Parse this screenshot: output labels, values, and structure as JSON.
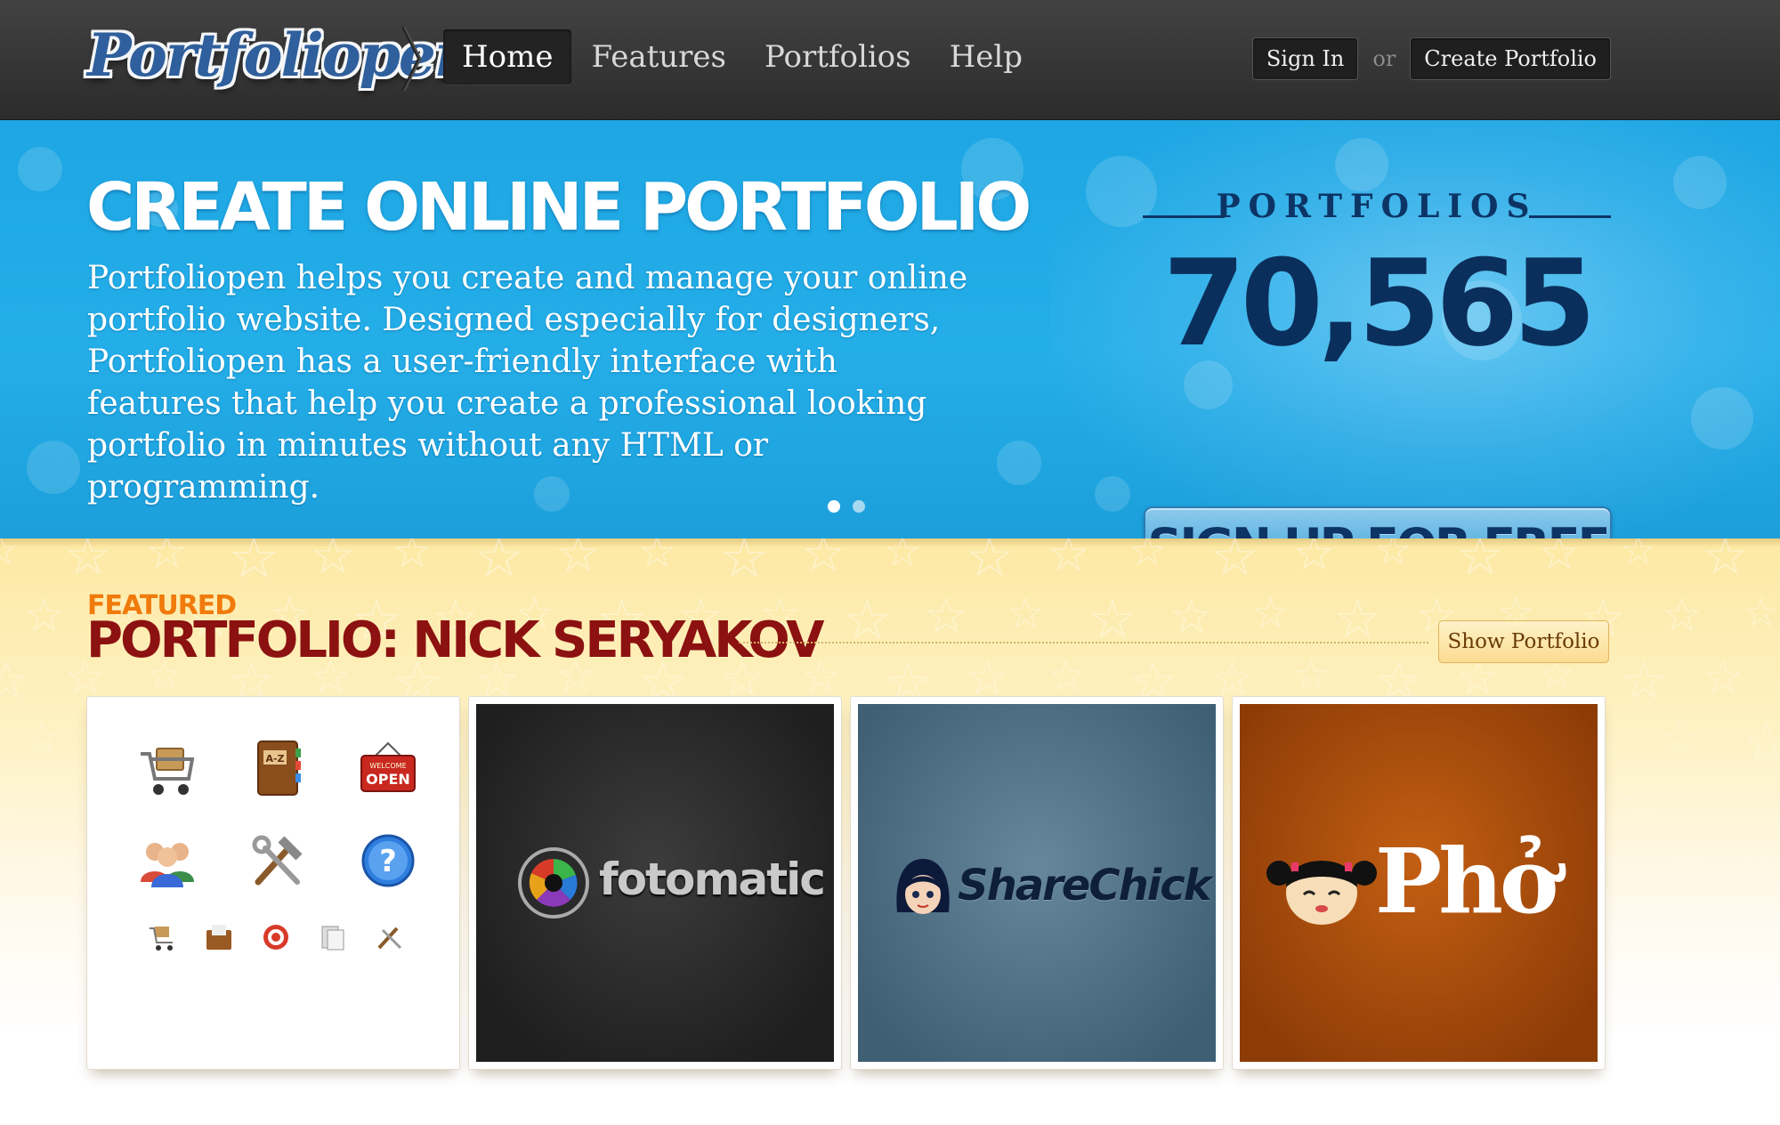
{
  "header": {
    "logo_text": "Portfoliopen",
    "nav": [
      {
        "label": "Home",
        "active": true
      },
      {
        "label": "Features"
      },
      {
        "label": "Portfolios"
      },
      {
        "label": "Help"
      }
    ],
    "sign_in": "Sign In",
    "or": "or",
    "create_portfolio": "Create Portfolio"
  },
  "hero": {
    "title": "CREATE ONLINE PORTFOLIO",
    "text": "Portfoliopen helps you create and manage your online portfolio website. Designed especially for designers, Portfoliopen has a user-friendly interface with features that help you create a professional looking portfolio in minutes without any HTML or programming.",
    "slides": 2,
    "active_slide": 1,
    "counter_label": "PORTFOLIOS",
    "counter_value": "70,565",
    "signup_label": "SIGN UP FOR FREE"
  },
  "featured": {
    "kicker": "FEATURED",
    "title": "PORTFOLIO: NICK SERYAKOV",
    "show_button": "Show Portfolio",
    "tiles": [
      {
        "kind": "icons",
        "sign_text": "OPEN",
        "sign_small": "WELCOME",
        "book_text": "A-Z"
      },
      {
        "kind": "logo",
        "text": "fotomatic"
      },
      {
        "kind": "logo",
        "text": "ShareChick"
      },
      {
        "kind": "logo",
        "text": "Phở"
      }
    ]
  },
  "colors": {
    "header_bg": "#333333",
    "hero_bg": "#22aae6",
    "counter_navy": "#0b2f5c",
    "featured_kicker": "#f07a0c",
    "featured_title": "#8c1111"
  }
}
